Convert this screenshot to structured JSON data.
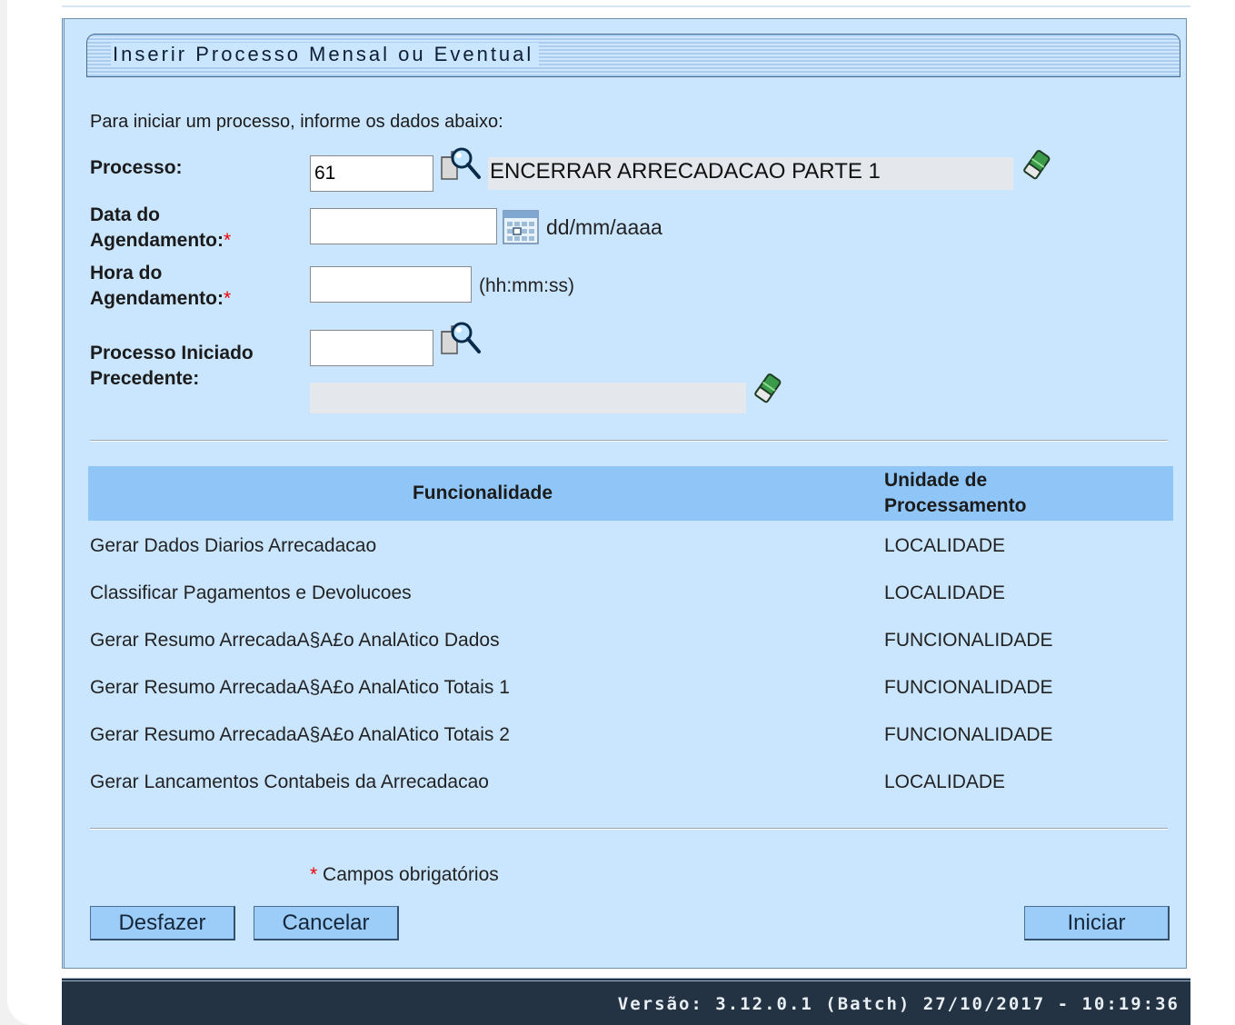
{
  "header": {
    "title": "Inserir Processo Mensal ou Eventual"
  },
  "intro": "Para iniciar um processo, informe os dados abaixo:",
  "form": {
    "processo": {
      "label": "Processo:",
      "value": "61",
      "description": "ENCERRAR ARRECADACAO PARTE 1"
    },
    "data": {
      "label_line1": "Data do",
      "label_line2": "Agendamento:",
      "required_mark": "*",
      "value": "",
      "hint": "dd/mm/aaaa"
    },
    "hora": {
      "label_line1": "Hora do",
      "label_line2": "Agendamento:",
      "required_mark": "*",
      "value": "",
      "hint": "(hh:mm:ss)"
    },
    "precedente": {
      "label_line1": "Processo Iniciado",
      "label_line2": "Precedente:",
      "value": "",
      "description": ""
    }
  },
  "table": {
    "headers": {
      "funcionalidade": "Funcionalidade",
      "unidade_line1": "Unidade de",
      "unidade_line2": "Processamento"
    },
    "rows": [
      {
        "funcionalidade": "Gerar Dados Diarios Arrecadacao",
        "unidade": "LOCALIDADE"
      },
      {
        "funcionalidade": "Classificar Pagamentos e Devolucoes",
        "unidade": "LOCALIDADE"
      },
      {
        "funcionalidade": "Gerar Resumo ArrecadaA§A£o AnalAtico Dados",
        "unidade": "FUNCIONALIDADE"
      },
      {
        "funcionalidade": "Gerar Resumo ArrecadaA§A£o AnalAtico Totais 1",
        "unidade": "FUNCIONALIDADE"
      },
      {
        "funcionalidade": "Gerar Resumo ArrecadaA§A£o AnalAtico Totais 2",
        "unidade": "FUNCIONALIDADE"
      },
      {
        "funcionalidade": "Gerar Lancamentos Contabeis da Arrecadacao",
        "unidade": "LOCALIDADE"
      }
    ]
  },
  "note": {
    "mark": "*",
    "text": " Campos obrigatórios"
  },
  "buttons": {
    "desfazer": "Desfazer",
    "cancelar": "Cancelar",
    "iniciar": "Iniciar"
  },
  "footer": {
    "version": "Versão: 3.12.0.1 (Batch) 27/10/2017 - 10:19:36"
  },
  "icons": {
    "search": "magnifier-search-icon",
    "eraser": "eraser-icon",
    "calendar": "calendar-icon"
  },
  "colors": {
    "panel_bg": "#cae5fe",
    "table_header": "#8fc6f7",
    "button_bg": "#9bcdf8",
    "footer_bg": "#233343",
    "required": "#ee0000"
  }
}
